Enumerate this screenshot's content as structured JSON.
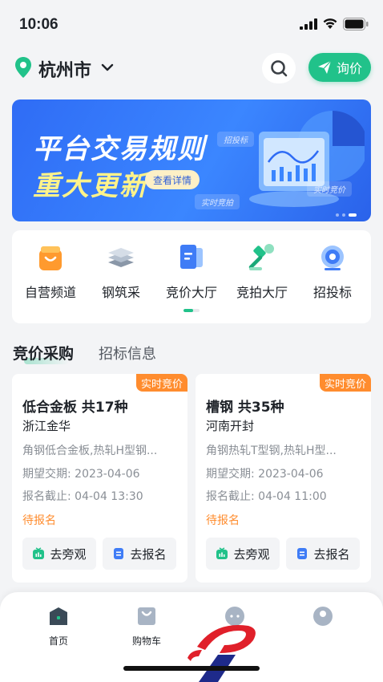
{
  "status_bar": {
    "time": "10:06"
  },
  "header": {
    "city": "杭州市",
    "inquiry_label": "询价"
  },
  "banner": {
    "title_line1": "平台交易规则",
    "title_line2": "重大更新",
    "detail_button": "查看详情",
    "tag_bidding": "招投标",
    "tag_live_auction": "实时竞拍",
    "tag_live_price": "实时竞价"
  },
  "menu": {
    "items": [
      {
        "label": "自营频道",
        "icon": "shopping-bag-icon"
      },
      {
        "label": "钢筑采",
        "icon": "steel-stack-icon"
      },
      {
        "label": "竞价大厅",
        "icon": "bidding-document-icon"
      },
      {
        "label": "竞拍大厅",
        "icon": "auction-gavel-icon"
      },
      {
        "label": "招投标",
        "icon": "tender-target-icon"
      }
    ]
  },
  "section_tabs": {
    "active": "竞价采购",
    "inactive": "招标信息"
  },
  "cards": [
    {
      "badge": "实时竞价",
      "title": "低合金板 共17种",
      "location": "浙江金华",
      "spec": "角钢低合金板,热轧H型钢...",
      "delivery": "期望交期: 2023-04-06",
      "deadline": "报名截止: 04-04 13:30",
      "status": "待报名",
      "watch_label": "去旁观",
      "signup_label": "去报名"
    },
    {
      "badge": "实时竞价",
      "title": "槽钢 共35种",
      "location": "河南开封",
      "spec": "角钢热轧T型钢,热轧H型...",
      "delivery": "期望交期: 2023-04-06",
      "deadline": "报名截止: 04-04 11:00",
      "status": "待报名",
      "watch_label": "去旁观",
      "signup_label": "去报名"
    }
  ],
  "tabbar": {
    "items": [
      {
        "label": "首页",
        "icon": "home-icon"
      },
      {
        "label": "购物车",
        "icon": "cart-bag-icon"
      },
      {
        "label": "",
        "icon": "message-icon"
      },
      {
        "label": "",
        "icon": "profile-icon"
      }
    ]
  },
  "colors": {
    "accent": "#21c28a",
    "badge": "#ff8c2e",
    "banner": "#2f6cf5"
  }
}
